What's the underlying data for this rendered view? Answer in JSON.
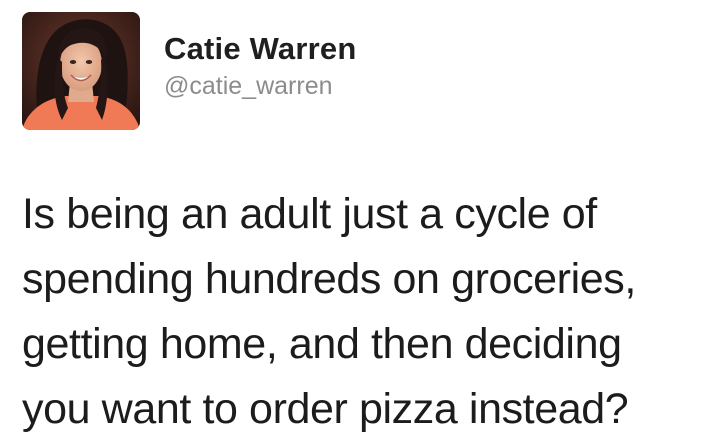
{
  "tweet": {
    "author": {
      "display_name": "Catie Warren",
      "handle": "@catie_warren"
    },
    "text_lines": [
      "Is being an adult just a cycle of",
      "spending hundreds on groceries,",
      "getting home, and then deciding",
      "you want to order pizza instead?"
    ]
  }
}
